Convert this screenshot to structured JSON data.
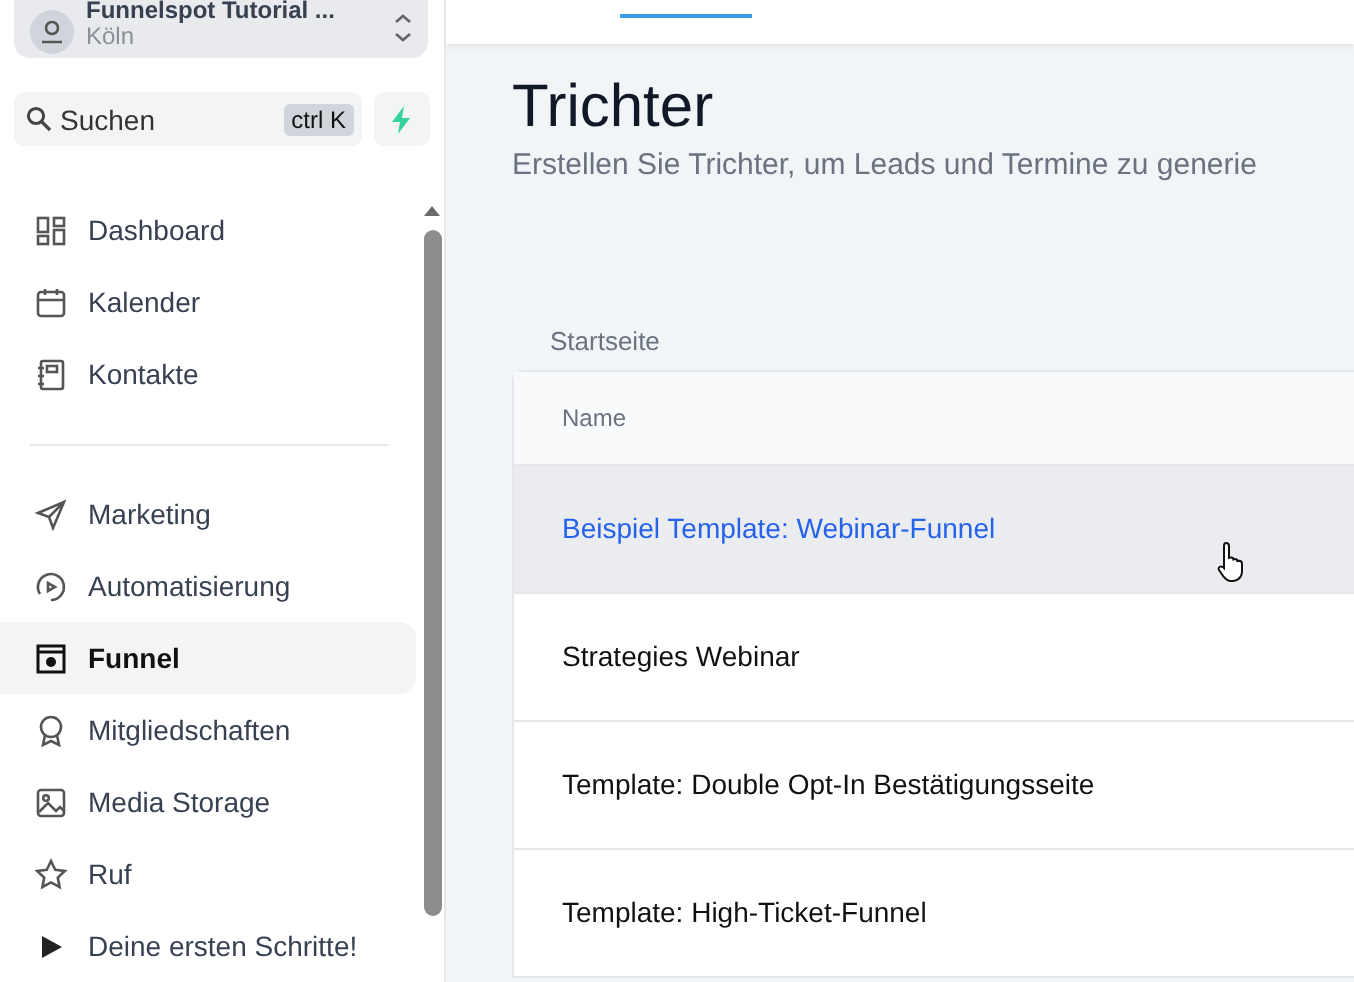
{
  "account": {
    "name": "Funnelspot Tutorial ...",
    "location": "Köln"
  },
  "search": {
    "placeholder": "Suchen",
    "shortcut": "ctrl K"
  },
  "sidebar": {
    "groups": [
      {
        "items": [
          {
            "label": "Dashboard",
            "kind": "dashboard",
            "selected": false
          },
          {
            "label": "Kalender",
            "kind": "calendar",
            "selected": false
          },
          {
            "label": "Kontakte",
            "kind": "contacts",
            "selected": false
          }
        ]
      },
      {
        "items": [
          {
            "label": "Marketing",
            "kind": "send",
            "selected": false
          },
          {
            "label": "Automatisierung",
            "kind": "play",
            "selected": false
          },
          {
            "label": "Funnel",
            "kind": "browser",
            "selected": true
          },
          {
            "label": "Mitgliedschaften",
            "kind": "award",
            "selected": false
          },
          {
            "label": "Media Storage",
            "kind": "image",
            "selected": false
          },
          {
            "label": "Ruf",
            "kind": "star",
            "selected": false
          },
          {
            "label": "Deine ersten Schritte!",
            "kind": "triangle",
            "selected": false
          }
        ]
      }
    ]
  },
  "page": {
    "title": "Trichter",
    "subtitle": "Erstellen Sie Trichter, um Leads und Termine zu generie",
    "breadcrumb": "Startseite"
  },
  "table": {
    "columns": [
      "Name"
    ],
    "rows": [
      {
        "name": "Beispiel Template: Webinar-Funnel",
        "selected": true
      },
      {
        "name": "Strategies Webinar",
        "selected": false
      },
      {
        "name": "Template: Double Opt-In Bestätigungsseite",
        "selected": false
      },
      {
        "name": "Template: High-Ticket-Funnel",
        "selected": false
      }
    ]
  }
}
